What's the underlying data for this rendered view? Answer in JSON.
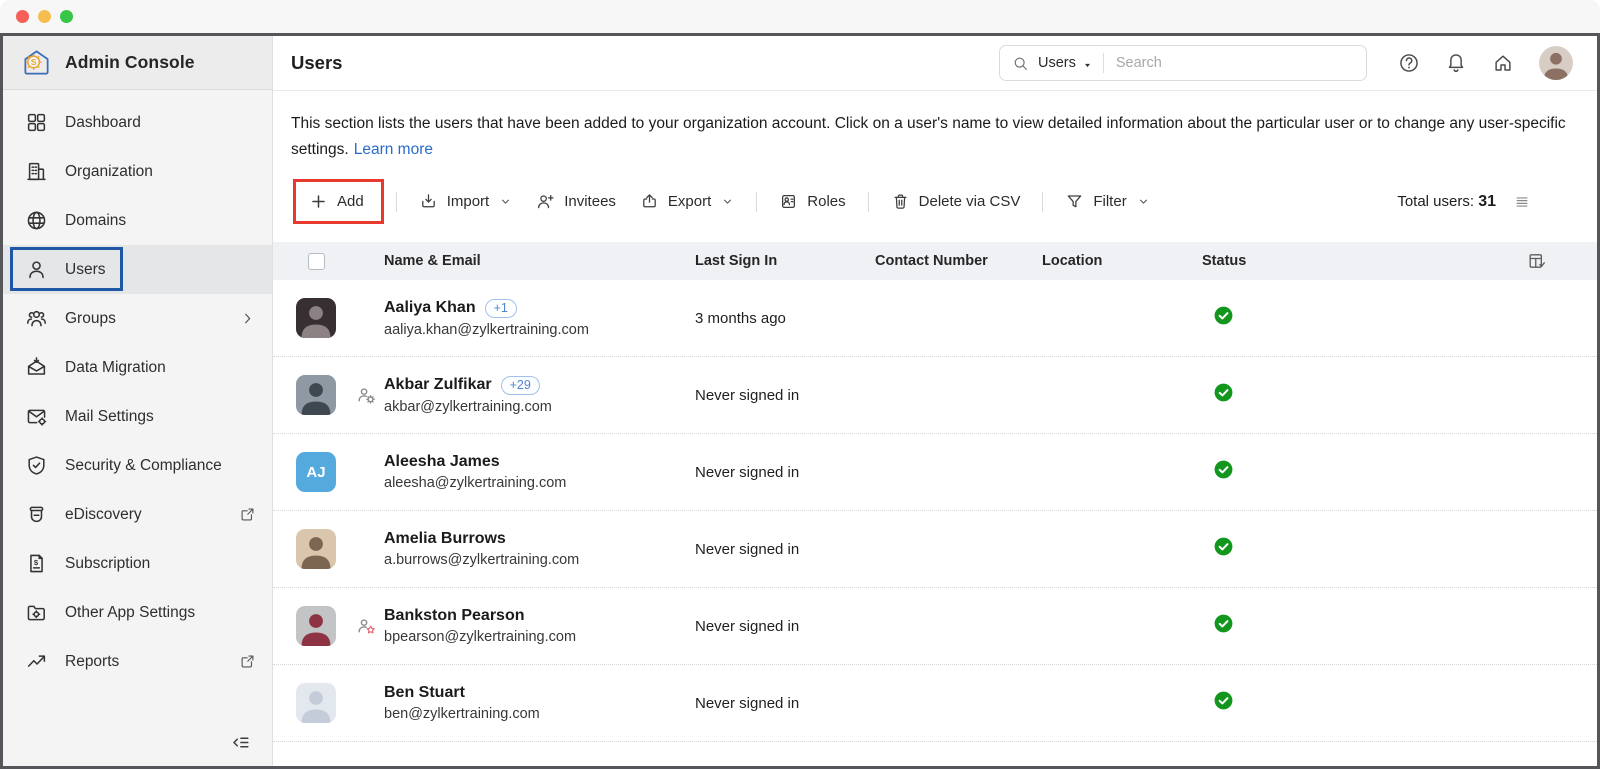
{
  "sidebar": {
    "brand": "Admin Console",
    "items": [
      {
        "label": "Dashboard",
        "icon": "dashboard-icon"
      },
      {
        "label": "Organization",
        "icon": "organization-icon"
      },
      {
        "label": "Domains",
        "icon": "domains-icon"
      },
      {
        "label": "Users",
        "icon": "users-icon",
        "selected": true,
        "annotated": true
      },
      {
        "label": "Groups",
        "icon": "groups-icon",
        "chevron": true
      },
      {
        "label": "Data Migration",
        "icon": "data-migration-icon"
      },
      {
        "label": "Mail Settings",
        "icon": "mail-settings-icon"
      },
      {
        "label": "Security & Compliance",
        "icon": "security-icon"
      },
      {
        "label": "eDiscovery",
        "icon": "ediscovery-icon",
        "external": true
      },
      {
        "label": "Subscription",
        "icon": "subscription-icon"
      },
      {
        "label": "Other App Settings",
        "icon": "other-apps-icon"
      },
      {
        "label": "Reports",
        "icon": "reports-icon",
        "external": true
      }
    ]
  },
  "header": {
    "title": "Users",
    "search_scope": "Users",
    "search_placeholder": "Search",
    "avatar": {
      "bg": "#d8cdc5",
      "fg": "#8b7064"
    }
  },
  "description": {
    "text": "This section lists the users that have been added to your organization account. Click on a user's name to view detailed information about the particular user or to change any user-specific settings.",
    "link_label": "Learn more"
  },
  "toolbar": {
    "buttons": [
      {
        "label": "Add",
        "icon": "plus-icon",
        "annotated": true,
        "divider_after": true
      },
      {
        "label": "Import",
        "icon": "import-icon",
        "chevron": true
      },
      {
        "label": "Invitees",
        "icon": "invitees-icon"
      },
      {
        "label": "Export",
        "icon": "export-icon",
        "chevron": true,
        "divider_after": true
      },
      {
        "label": "Roles",
        "icon": "roles-icon",
        "divider_after": true
      },
      {
        "label": "Delete via CSV",
        "icon": "trash-icon",
        "divider_after": true
      },
      {
        "label": "Filter",
        "icon": "filter-icon",
        "chevron": true
      }
    ],
    "total_label": "Total users:",
    "total_value": "31"
  },
  "table": {
    "columns": [
      "Name & Email",
      "Last Sign In",
      "Contact Number",
      "Location",
      "Status"
    ],
    "rows": [
      {
        "name": "Aaliya Khan",
        "email": "aaliya.khan@zylkertraining.com",
        "badge": "+1",
        "last_sign_in": "3 months ago",
        "status": "active",
        "avatar": {
          "type": "photo",
          "bg": "#372f32",
          "fg": "#8c8284"
        }
      },
      {
        "name": "Akbar Zulfikar",
        "email": "akbar@zylkertraining.com",
        "badge": "+29",
        "last_sign_in": "Never signed in",
        "status": "active",
        "role_icon": "super-admin-icon",
        "avatar": {
          "type": "photo",
          "bg": "#8e99a4",
          "fg": "#3f4750"
        }
      },
      {
        "name": "Aleesha James",
        "email": "aleesha@zylkertraining.com",
        "last_sign_in": "Never signed in",
        "status": "active",
        "avatar": {
          "type": "initials",
          "text": "AJ",
          "bg": "#55aadd",
          "fg": "#ffffff"
        }
      },
      {
        "name": "Amelia Burrows",
        "email": "a.burrows@zylkertraining.com",
        "last_sign_in": "Never signed in",
        "status": "active",
        "avatar": {
          "type": "photo",
          "bg": "#d9c6ac",
          "fg": "#7d6651"
        }
      },
      {
        "name": "Bankston Pearson",
        "email": "bpearson@zylkertraining.com",
        "last_sign_in": "Never signed in",
        "status": "active",
        "role_icon": "custom-admin-icon",
        "avatar": {
          "type": "photo",
          "bg": "#c2c4c6",
          "fg": "#8e3344"
        }
      },
      {
        "name": "Ben Stuart",
        "email": "ben@zylkertraining.com",
        "last_sign_in": "Never signed in",
        "status": "active",
        "avatar": {
          "type": "placeholder",
          "bg": "#e3e7ee",
          "fg": "#c4ccd9"
        }
      }
    ]
  },
  "colors": {
    "annotation_red": "#e8392e",
    "annotation_blue": "#1d57a5",
    "status_green": "#12961e",
    "link_blue": "#2a6bcc",
    "badge_blue": "#4f87cc",
    "brand_orange": "#e9a63a",
    "brand_blue": "#3a6db5"
  }
}
